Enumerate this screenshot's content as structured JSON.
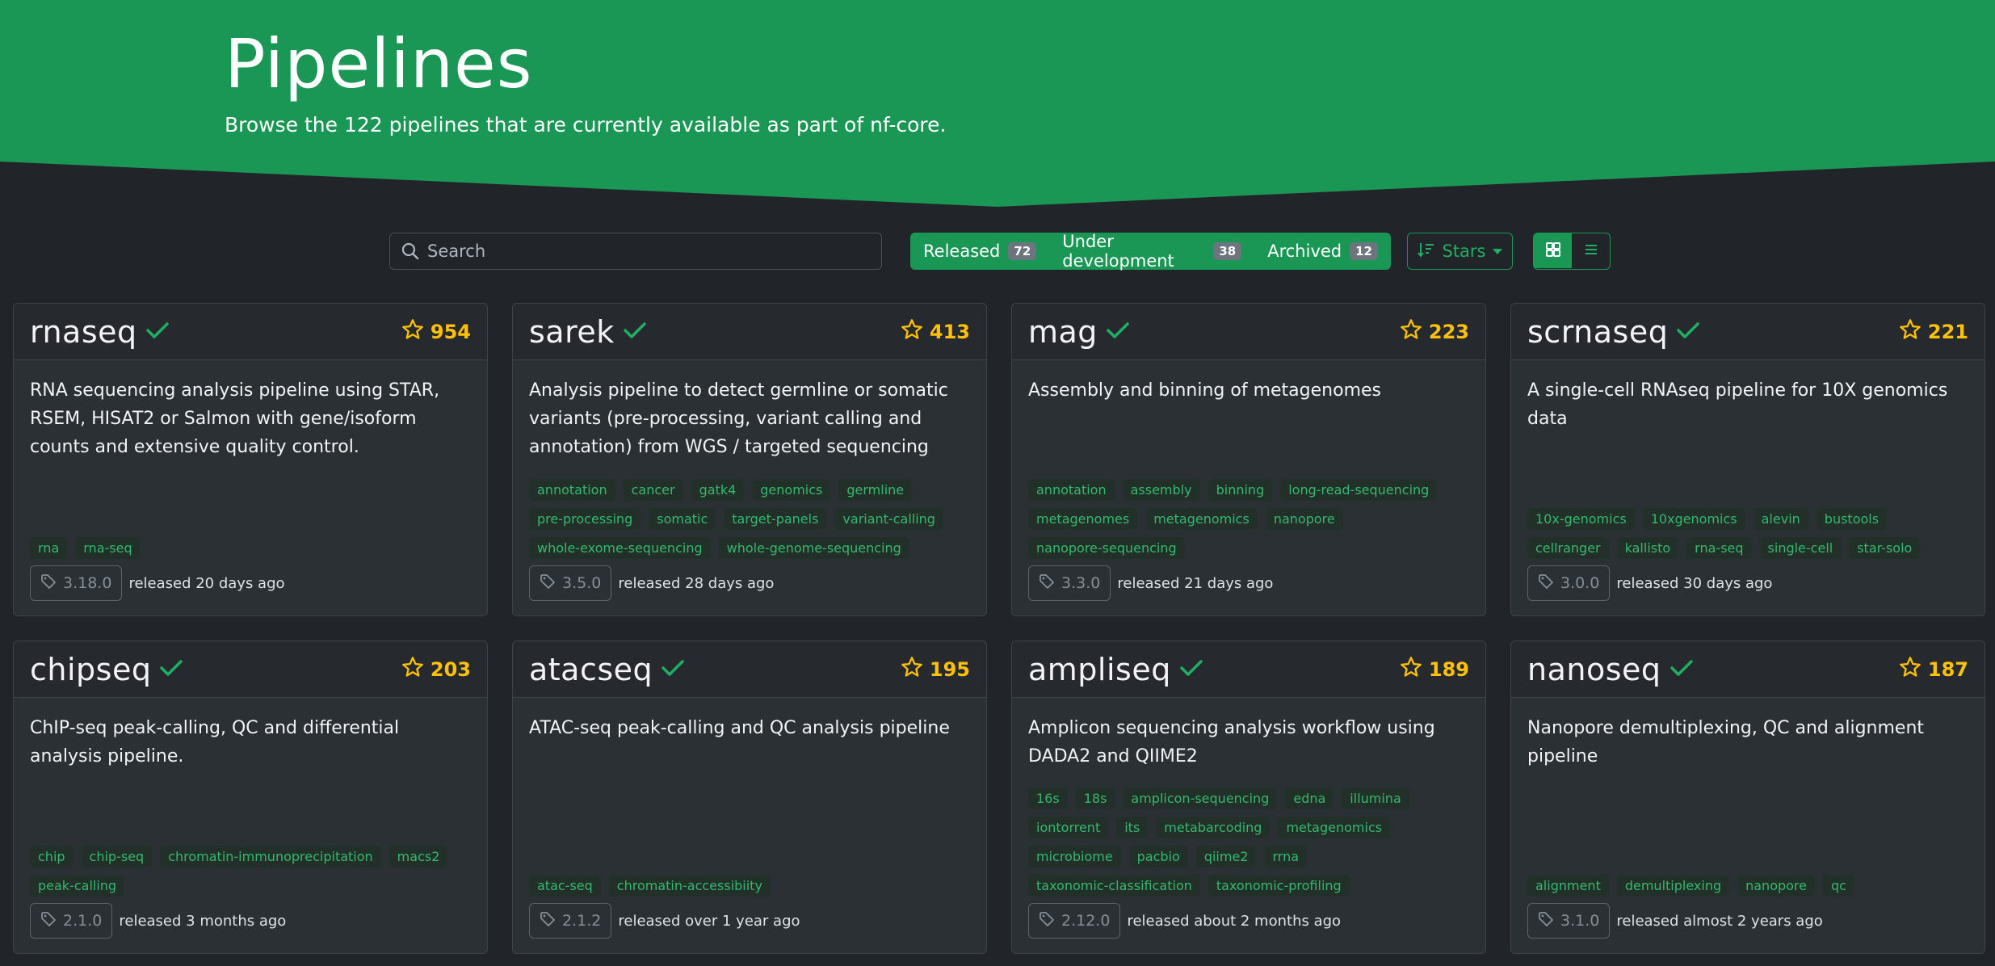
{
  "header": {
    "title": "Pipelines",
    "subtitle": "Browse the 122 pipelines that are currently available as part of nf-core."
  },
  "toolbar": {
    "search_placeholder": "Search",
    "filters": [
      {
        "label": "Released",
        "count": "72"
      },
      {
        "label": "Under development",
        "count": "38"
      },
      {
        "label": "Archived",
        "count": "12"
      }
    ],
    "sort_label": "Stars",
    "view_modes": [
      "grid-icon",
      "list-icon"
    ]
  },
  "colors": {
    "brand_green": "#1a9655",
    "star_yellow": "#ffc107",
    "tag_text": "#33b96e",
    "background": "#212529"
  },
  "pipelines": [
    {
      "name": "rnaseq",
      "stars": "954",
      "description": "RNA sequencing analysis pipeline using STAR, RSEM, HISAT2 or Salmon with gene/isoform counts and extensive quality control.",
      "tags": [
        "rna",
        "rna-seq"
      ],
      "version": "3.18.0",
      "released": "released 20 days ago"
    },
    {
      "name": "sarek",
      "stars": "413",
      "description": "Analysis pipeline to detect germline or somatic variants (pre-processing, variant calling and annotation) from WGS / targeted sequencing",
      "tags": [
        "annotation",
        "cancer",
        "gatk4",
        "genomics",
        "germline",
        "pre-processing",
        "somatic",
        "target-panels",
        "variant-calling",
        "whole-exome-sequencing",
        "whole-genome-sequencing"
      ],
      "version": "3.5.0",
      "released": "released 28 days ago"
    },
    {
      "name": "mag",
      "stars": "223",
      "description": "Assembly and binning of metagenomes",
      "tags": [
        "annotation",
        "assembly",
        "binning",
        "long-read-sequencing",
        "metagenomes",
        "metagenomics",
        "nanopore",
        "nanopore-sequencing"
      ],
      "version": "3.3.0",
      "released": "released 21 days ago"
    },
    {
      "name": "scrnaseq",
      "stars": "221",
      "description": "A single-cell RNAseq pipeline for 10X genomics data",
      "tags": [
        "10x-genomics",
        "10xgenomics",
        "alevin",
        "bustools",
        "cellranger",
        "kallisto",
        "rna-seq",
        "single-cell",
        "star-solo"
      ],
      "version": "3.0.0",
      "released": "released 30 days ago"
    },
    {
      "name": "chipseq",
      "stars": "203",
      "description": "ChIP-seq peak-calling, QC and differential analysis pipeline.",
      "tags": [
        "chip",
        "chip-seq",
        "chromatin-immunoprecipitation",
        "macs2",
        "peak-calling"
      ],
      "version": "2.1.0",
      "released": "released 3 months ago"
    },
    {
      "name": "atacseq",
      "stars": "195",
      "description": "ATAC-seq peak-calling and QC analysis pipeline",
      "tags": [
        "atac-seq",
        "chromatin-accessibiity"
      ],
      "version": "2.1.2",
      "released": "released over 1 year ago"
    },
    {
      "name": "ampliseq",
      "stars": "189",
      "description": "Amplicon sequencing analysis workflow using DADA2 and QIIME2",
      "tags": [
        "16s",
        "18s",
        "amplicon-sequencing",
        "edna",
        "illumina",
        "iontorrent",
        "its",
        "metabarcoding",
        "metagenomics",
        "microbiome",
        "pacbio",
        "qiime2",
        "rrna",
        "taxonomic-classification",
        "taxonomic-profiling"
      ],
      "version": "2.12.0",
      "released": "released about 2 months ago"
    },
    {
      "name": "nanoseq",
      "stars": "187",
      "description": "Nanopore demultiplexing, QC and alignment pipeline",
      "tags": [
        "alignment",
        "demultiplexing",
        "nanopore",
        "qc"
      ],
      "version": "3.1.0",
      "released": "released almost 2 years ago"
    }
  ]
}
